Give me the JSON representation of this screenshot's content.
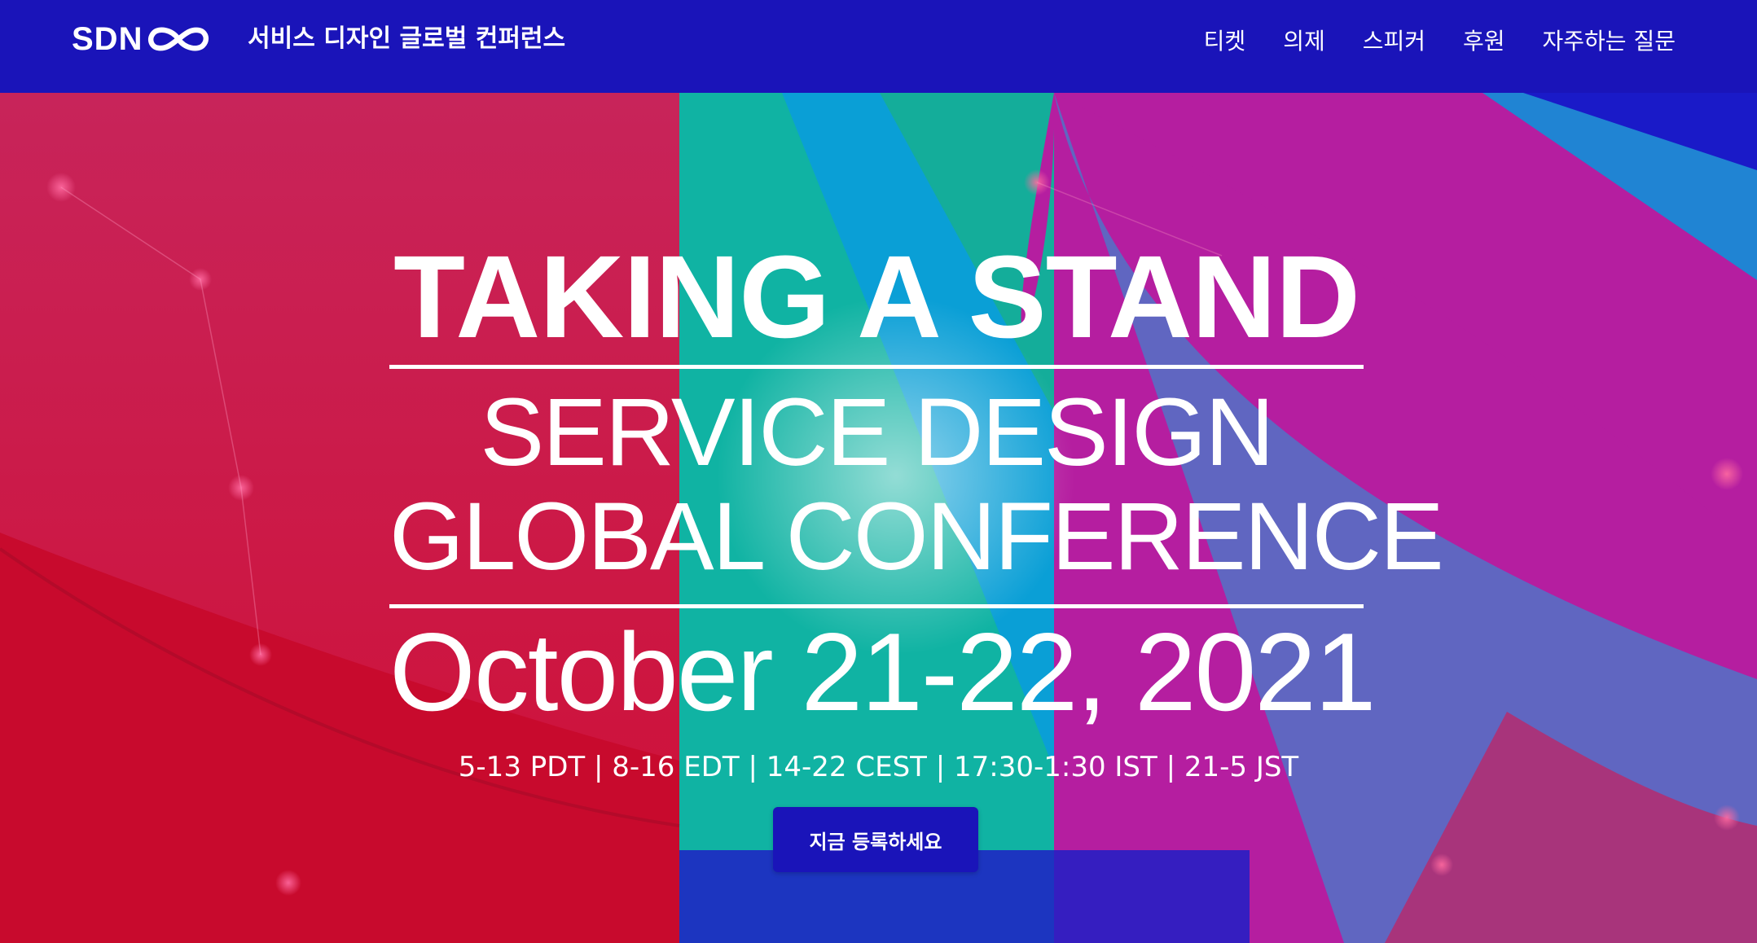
{
  "header": {
    "logo_text": "SDN",
    "site_title": "서비스 디자인 글로벌 컨퍼런스",
    "nav": [
      {
        "label": "티켓"
      },
      {
        "label": "의제"
      },
      {
        "label": "스피커"
      },
      {
        "label": "후원"
      },
      {
        "label": "자주하는 질문"
      }
    ]
  },
  "hero": {
    "headline": "TAKING A STAND",
    "subtitle_line1": "SERVICE DESIGN",
    "subtitle_line2": "GLOBAL CONFERENCE",
    "date": "October 21-22, 2021",
    "times": "5-13 PDT | 8-16 EDT | 14-22 CEST | 17:30-1:30 IST | 21-5 JST",
    "cta_label": "지금 등록하세요"
  },
  "colors": {
    "brand_blue": "#1a14b9",
    "red": "#d4143f",
    "magenta": "#b51ea0",
    "teal": "#12b4a6",
    "cyan": "#0aa0dc"
  },
  "icons": {
    "logo_mark": "infinity-icon"
  }
}
